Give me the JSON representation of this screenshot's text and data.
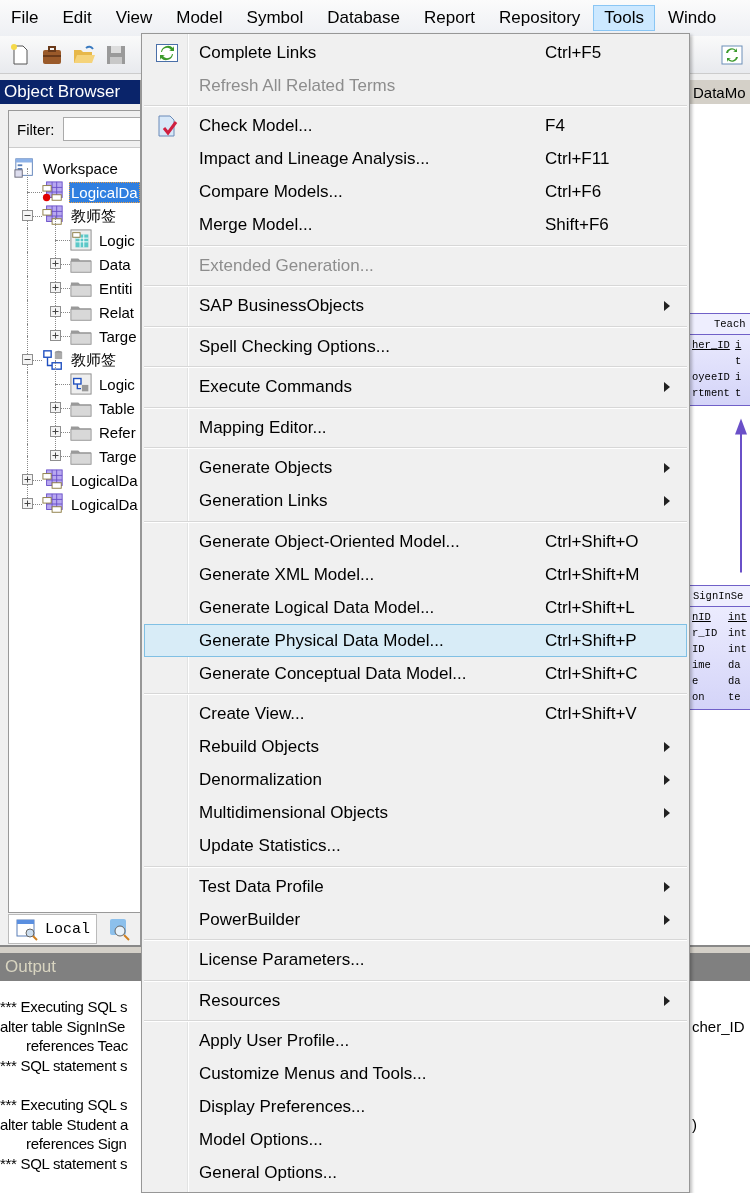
{
  "menubar": [
    {
      "label": "File",
      "selected": false
    },
    {
      "label": "Edit",
      "selected": false
    },
    {
      "label": "View",
      "selected": false
    },
    {
      "label": "Model",
      "selected": false
    },
    {
      "label": "Symbol",
      "selected": false
    },
    {
      "label": "Database",
      "selected": false
    },
    {
      "label": "Report",
      "selected": false
    },
    {
      "label": "Repository",
      "selected": false
    },
    {
      "label": "Tools",
      "selected": true
    },
    {
      "label": "Windo",
      "selected": false
    }
  ],
  "object_browser": {
    "title": "Object Browser",
    "filter_label": "Filter:",
    "tree": [
      {
        "label": "Workspace",
        "kind": "workspace",
        "selected": false,
        "children": [
          {
            "label": "LogicalDa",
            "kind": "logical-model",
            "selected": true,
            "active": true
          },
          {
            "label": "教师签",
            "kind": "logical-model",
            "selected": false,
            "active": false,
            "expanded": true,
            "children": [
              {
                "label": "Logic",
                "kind": "logical-diagram",
                "selected": false
              },
              {
                "label": "Data",
                "kind": "folder",
                "selected": false,
                "expanded": false
              },
              {
                "label": "Entiti",
                "kind": "folder",
                "selected": false,
                "expanded": false
              },
              {
                "label": "Relat",
                "kind": "folder",
                "selected": false,
                "expanded": false
              },
              {
                "label": "Targe",
                "kind": "folder",
                "selected": false,
                "expanded": false
              }
            ]
          },
          {
            "label": "教师签",
            "kind": "physical-model",
            "selected": false,
            "active": false,
            "expanded": true,
            "children": [
              {
                "label": "Logic",
                "kind": "physical-diagram",
                "selected": false
              },
              {
                "label": "Table",
                "kind": "folder",
                "selected": false,
                "expanded": false
              },
              {
                "label": "Refer",
                "kind": "folder",
                "selected": false,
                "expanded": false
              },
              {
                "label": "Targe",
                "kind": "folder",
                "selected": false,
                "expanded": false
              }
            ]
          },
          {
            "label": "LogicalDa",
            "kind": "logical-model",
            "selected": false,
            "active": false,
            "expanded": false
          },
          {
            "label": "LogicalDa",
            "kind": "logical-model",
            "selected": false,
            "active": false,
            "expanded": false
          }
        ]
      }
    ],
    "tab": {
      "label": "Local",
      "selected": true
    }
  },
  "diagram": {
    "tab": "DataMo",
    "entities": [
      {
        "name": "Teach",
        "columns": [
          {
            "name": "her_ID",
            "type": "i",
            "key": true
          },
          {
            "type": "t",
            "key": false
          },
          {
            "name": "oyeeID",
            "type": "i",
            "key": false
          },
          {
            "name": "rtment",
            "type": "t",
            "key": false
          }
        ]
      },
      {
        "name": "SignInSe",
        "columns": [
          {
            "name": "nID",
            "type": "int",
            "key": true
          },
          {
            "name": "r_ID",
            "type": "int",
            "key": false
          },
          {
            "name": "ID",
            "type": "int",
            "key": false
          },
          {
            "name": "ime",
            "type": "da",
            "key": false
          },
          {
            "name": "e",
            "type": "da",
            "key": false
          },
          {
            "name": "on",
            "type": "te",
            "key": false
          }
        ]
      }
    ]
  },
  "output": {
    "title": "Output",
    "blocks": [
      {
        "lines": [
          {
            "text": "*** Executing SQL s",
            "indent": false
          },
          {
            "text": "alter table SignInSe",
            "indent": false,
            "tail": "cher_ID"
          },
          {
            "text": "references Teac",
            "indent": true
          },
          {
            "text": "*** SQL statement s",
            "indent": false
          }
        ]
      },
      {
        "lines": [
          {
            "text": "*** Executing SQL s",
            "indent": false
          },
          {
            "text": "alter table Student a",
            "indent": false,
            "tail": ")"
          },
          {
            "text": "references Sign",
            "indent": true
          },
          {
            "text": "*** SQL statement s",
            "indent": false
          }
        ]
      }
    ]
  },
  "menu": {
    "items": [
      {
        "kind": "item",
        "label": "Complete Links",
        "shortcut": "Ctrl+F5",
        "disabled": false,
        "submenu": false,
        "selected": false
      },
      {
        "kind": "item",
        "label": "Refresh All Related Terms",
        "disabled": true,
        "submenu": false,
        "selected": false
      },
      {
        "kind": "separator"
      },
      {
        "kind": "item",
        "label": "Check Model...",
        "shortcut": "F4",
        "disabled": false,
        "submenu": false,
        "selected": false
      },
      {
        "kind": "item",
        "label": "Impact and Lineage Analysis...",
        "shortcut": "Ctrl+F11",
        "disabled": false,
        "submenu": false,
        "selected": false
      },
      {
        "kind": "item",
        "label": "Compare Models...",
        "shortcut": "Ctrl+F6",
        "disabled": false,
        "submenu": false,
        "selected": false
      },
      {
        "kind": "item",
        "label": "Merge Model...",
        "shortcut": "Shift+F6",
        "disabled": false,
        "submenu": false,
        "selected": false
      },
      {
        "kind": "separator"
      },
      {
        "kind": "item",
        "label": "Extended Generation...",
        "disabled": true,
        "submenu": false,
        "selected": false
      },
      {
        "kind": "separator"
      },
      {
        "kind": "item",
        "label": "SAP BusinessObjects",
        "disabled": false,
        "submenu": true,
        "selected": false
      },
      {
        "kind": "separator"
      },
      {
        "kind": "item",
        "label": "Spell Checking Options...",
        "disabled": false,
        "submenu": false,
        "selected": false
      },
      {
        "kind": "separator"
      },
      {
        "kind": "item",
        "label": "Execute Commands",
        "disabled": false,
        "submenu": true,
        "selected": false
      },
      {
        "kind": "separator"
      },
      {
        "kind": "item",
        "label": "Mapping Editor...",
        "disabled": false,
        "submenu": false,
        "selected": false
      },
      {
        "kind": "separator"
      },
      {
        "kind": "item",
        "label": "Generate Objects",
        "disabled": false,
        "submenu": true,
        "selected": false
      },
      {
        "kind": "item",
        "label": "Generation Links",
        "disabled": false,
        "submenu": true,
        "selected": false
      },
      {
        "kind": "separator"
      },
      {
        "kind": "item",
        "label": "Generate Object-Oriented Model...",
        "shortcut": "Ctrl+Shift+O",
        "disabled": false,
        "submenu": false,
        "selected": false
      },
      {
        "kind": "item",
        "label": "Generate XML Model...",
        "shortcut": "Ctrl+Shift+M",
        "disabled": false,
        "submenu": false,
        "selected": false
      },
      {
        "kind": "item",
        "label": "Generate Logical Data Model...",
        "shortcut": "Ctrl+Shift+L",
        "disabled": false,
        "submenu": false,
        "selected": false
      },
      {
        "kind": "item",
        "label": "Generate Physical Data Model...",
        "shortcut": "Ctrl+Shift+P",
        "disabled": false,
        "submenu": false,
        "selected": true
      },
      {
        "kind": "item",
        "label": "Generate Conceptual Data Model...",
        "shortcut": "Ctrl+Shift+C",
        "disabled": false,
        "submenu": false,
        "selected": false
      },
      {
        "kind": "separator"
      },
      {
        "kind": "item",
        "label": "Create View...",
        "shortcut": "Ctrl+Shift+V",
        "disabled": false,
        "submenu": false,
        "selected": false
      },
      {
        "kind": "item",
        "label": "Rebuild Objects",
        "disabled": false,
        "submenu": true,
        "selected": false
      },
      {
        "kind": "item",
        "label": "Denormalization",
        "disabled": false,
        "submenu": true,
        "selected": false
      },
      {
        "kind": "item",
        "label": "Multidimensional Objects",
        "disabled": false,
        "submenu": true,
        "selected": false
      },
      {
        "kind": "item",
        "label": "Update Statistics...",
        "disabled": false,
        "submenu": false,
        "selected": false
      },
      {
        "kind": "separator"
      },
      {
        "kind": "item",
        "label": "Test Data Profile",
        "disabled": false,
        "submenu": true,
        "selected": false
      },
      {
        "kind": "item",
        "label": "PowerBuilder",
        "disabled": false,
        "submenu": true,
        "selected": false
      },
      {
        "kind": "separator"
      },
      {
        "kind": "item",
        "label": "License Parameters...",
        "disabled": false,
        "submenu": false,
        "selected": false
      },
      {
        "kind": "separator"
      },
      {
        "kind": "item",
        "label": "Resources",
        "disabled": false,
        "submenu": true,
        "selected": false
      },
      {
        "kind": "separator"
      },
      {
        "kind": "item",
        "label": "Apply User Profile...",
        "disabled": false,
        "submenu": false,
        "selected": false
      },
      {
        "kind": "item",
        "label": "Customize Menus and Tools...",
        "disabled": false,
        "submenu": false,
        "selected": false
      },
      {
        "kind": "item",
        "label": "Display Preferences...",
        "disabled": false,
        "submenu": false,
        "selected": false
      },
      {
        "kind": "item",
        "label": "Model Options...",
        "disabled": false,
        "submenu": false,
        "selected": false
      },
      {
        "kind": "item",
        "label": "General Options...",
        "disabled": false,
        "submenu": false,
        "selected": false
      }
    ]
  }
}
